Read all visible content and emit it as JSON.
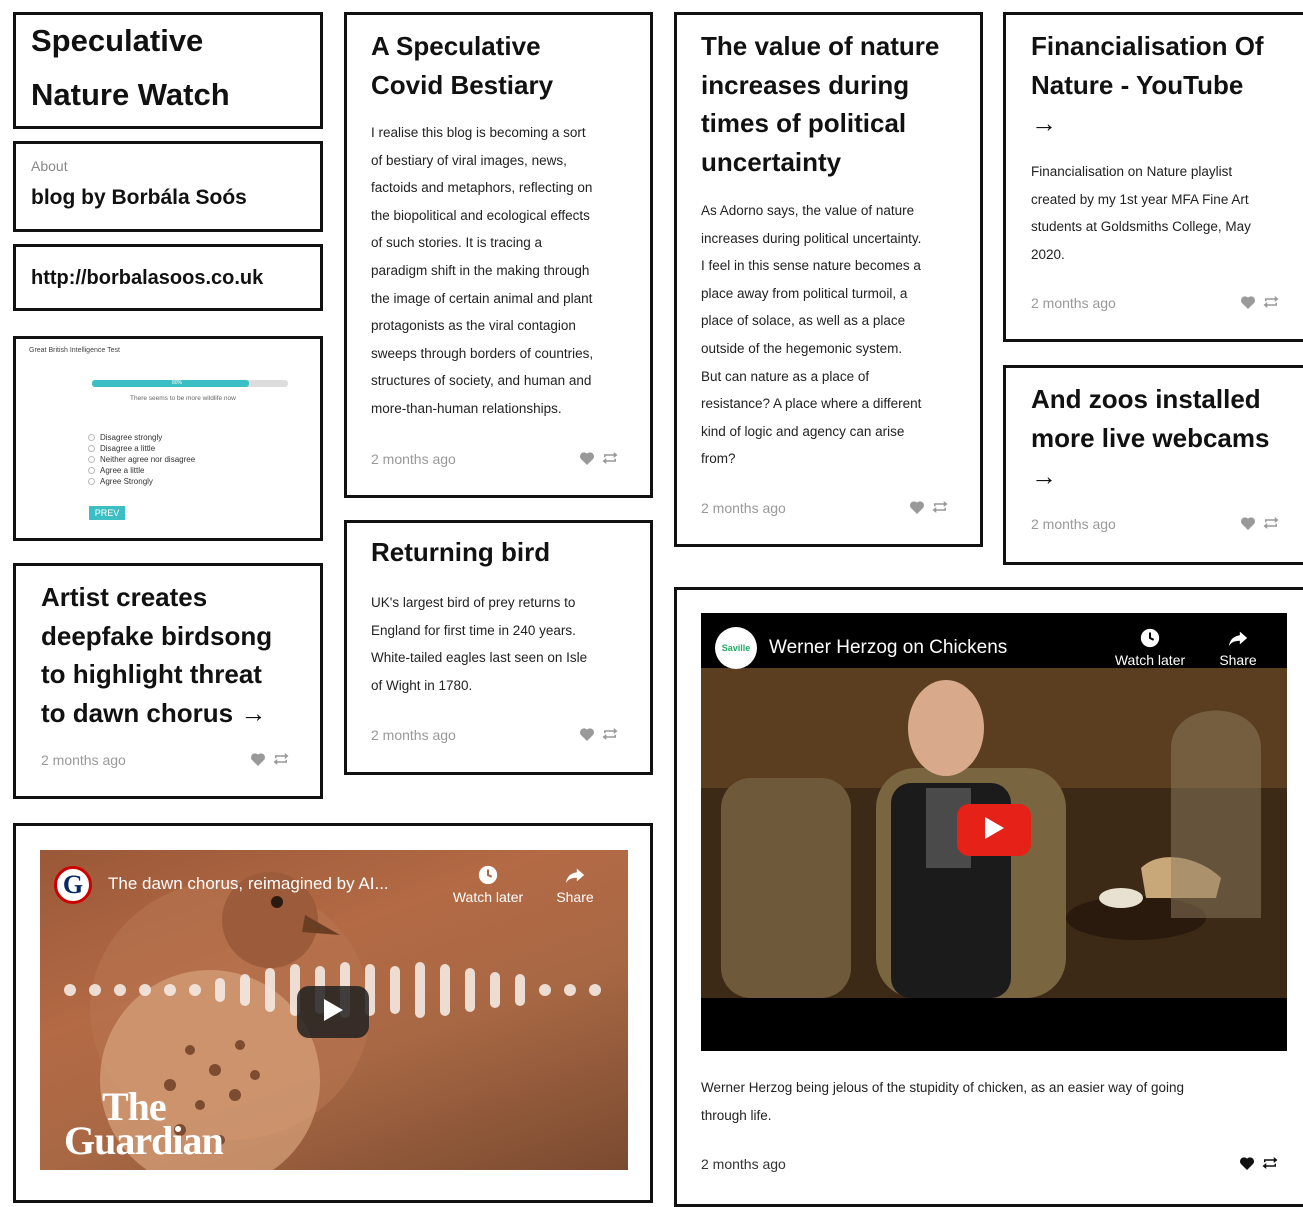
{
  "blog": {
    "title_line1": "Speculative",
    "title_line2": "Nature Watch",
    "about_label": "About",
    "about_text": "blog by Borbála Soós",
    "url": "http://borbalasoos.co.uk"
  },
  "survey": {
    "title": "Great British Intelligence Test",
    "progress_label": "80%",
    "progress": 0.8,
    "question": "There seems to be more wildlife now",
    "options": [
      "Disagree strongly",
      "Disagree a little",
      "Neither agree nor disagree",
      "Agree a little",
      "Agree Strongly"
    ],
    "prev_label": "PREV"
  },
  "posts": {
    "bestiary": {
      "title_line1": "A Speculative",
      "title_line2": "Covid Bestiary",
      "lines": [
        "I realise this blog is becoming a sort",
        "of bestiary of viral images, news,",
        "factoids and metaphors, reflecting on",
        "the biopolitical and ecological effects",
        "of such stories. It is tracing a",
        "paradigm shift in the making through",
        "the image of certain animal and plant",
        "protagonists as the viral contagion",
        "sweeps through borders of countries,",
        "structures of society, and human and",
        "more-than-human relationships."
      ],
      "time": "2 months ago"
    },
    "value": {
      "title_lines": [
        "The value of nature",
        "increases during",
        "times of political",
        "uncertainty"
      ],
      "lines": [
        "As Adorno says, the value of nature",
        "increases during political uncertainty.",
        "I feel in this sense nature becomes a",
        "place away from political turmoil, a",
        "place of solace, as well as a place",
        "outside of the hegemonic system.",
        "But can nature as a place of",
        "resistance? A place where a different",
        "kind of logic and agency can arise",
        "from?"
      ],
      "time": "2 months ago"
    },
    "financial": {
      "title_lines": [
        "Financialisation Of",
        "Nature - YouTube",
        "→"
      ],
      "lines": [
        "Financialisation on Nature playlist",
        "created by my 1st year MFA Fine Art",
        "students at Goldsmiths College, May",
        "2020."
      ],
      "time": "2 months ago"
    },
    "zoos": {
      "title_lines": [
        "And zoos installed",
        "more live webcams",
        "→"
      ],
      "time": "2 months ago"
    },
    "bird": {
      "title": "Returning bird",
      "lines": [
        "UK's largest bird of prey returns to",
        "England for first time in 240 years.",
        "White-tailed eagles last seen on Isle",
        "of Wight in 1780."
      ],
      "time": "2 months ago"
    },
    "artist": {
      "title_lines": [
        "Artist creates",
        "deepfake birdsong",
        "to highlight threat",
        "to dawn chorus →"
      ],
      "time": "2 months ago"
    },
    "herzog": {
      "channel": "Saville",
      "video_title": "Werner Herzog on Chickens",
      "watch_later": "Watch later",
      "share": "Share",
      "caption_line1": "Werner Herzog being jelous of the stupidity of chicken, as an easier way of going",
      "caption_line2": "through life.",
      "time": "2 months ago"
    },
    "dawn": {
      "channel": "G",
      "video_title": "The dawn chorus, reimagined by AI...",
      "watch_later": "Watch later",
      "share": "Share",
      "brand_line1": "The",
      "brand_line2": "Guardian"
    }
  },
  "colors": {
    "youtube_red": "#e62117",
    "accent_teal": "#3cbfc4",
    "guardian_blue": "#052962"
  }
}
